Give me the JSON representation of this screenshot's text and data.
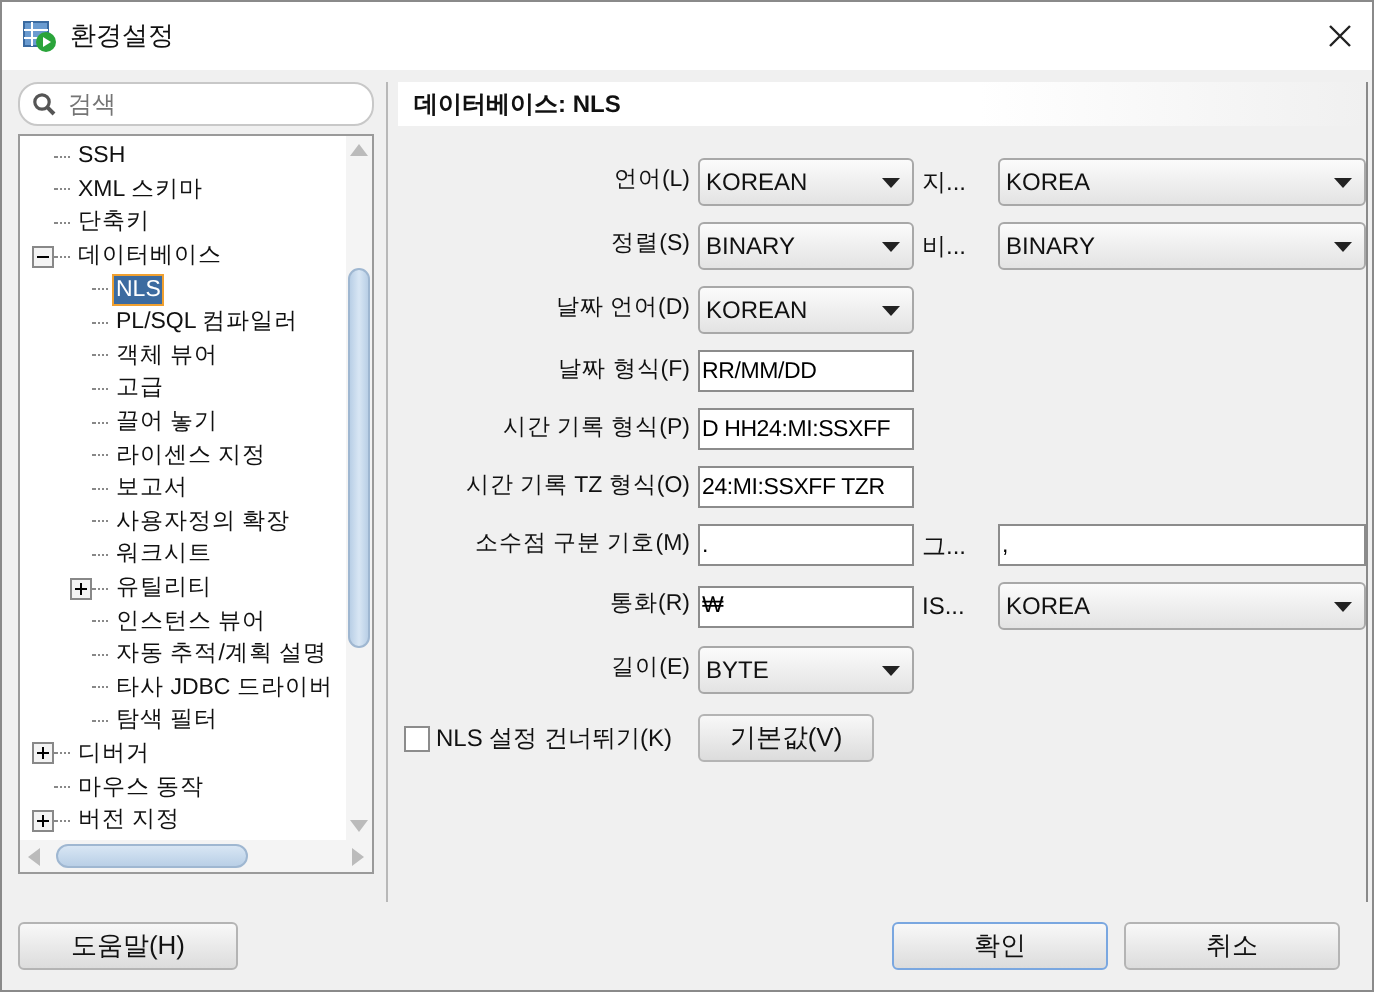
{
  "window": {
    "title": "환경설정"
  },
  "search": {
    "placeholder": "검색"
  },
  "tree": [
    {
      "label": "SSH",
      "selected": false
    },
    {
      "label": "XML 스키마",
      "selected": false
    },
    {
      "label": "단축키",
      "selected": false
    },
    {
      "label": "데이터베이스",
      "selected": false,
      "expanded": true,
      "children": [
        {
          "label": "NLS",
          "selected": true
        },
        {
          "label": "PL/SQL 컴파일러",
          "selected": false
        },
        {
          "label": "객체 뷰어",
          "selected": false
        },
        {
          "label": "고급",
          "selected": false
        },
        {
          "label": "끌어 놓기",
          "selected": false
        },
        {
          "label": "라이센스 지정",
          "selected": false
        },
        {
          "label": "보고서",
          "selected": false
        },
        {
          "label": "사용자정의 확장",
          "selected": false
        },
        {
          "label": "워크시트",
          "selected": false
        },
        {
          "label": "유틸리티",
          "selected": false,
          "expanded": false
        },
        {
          "label": "인스턴스 뷰어",
          "selected": false
        },
        {
          "label": "자동 추적/계획 설명",
          "selected": false
        },
        {
          "label": "타사 JDBC 드라이버",
          "selected": false
        },
        {
          "label": "탐색 필터",
          "selected": false
        }
      ]
    },
    {
      "label": "디버거",
      "selected": false,
      "expanded": false
    },
    {
      "label": "마우스 동작",
      "selected": false
    },
    {
      "label": "버전 지정",
      "selected": false,
      "expanded": false
    }
  ],
  "panel": {
    "title": "데이터베이스: NLS",
    "fields": [
      {
        "label": "언어(L)",
        "kind": "combo",
        "value": "KOREAN",
        "second": {
          "label": "지...",
          "kind": "combo",
          "value": "KOREA"
        }
      },
      {
        "label": "정렬(S)",
        "kind": "combo",
        "value": "BINARY",
        "second": {
          "label": "비...",
          "kind": "combo",
          "value": "BINARY"
        }
      },
      {
        "label": "날짜 언어(D)",
        "kind": "combo",
        "value": "KOREAN"
      },
      {
        "label": "날짜 형식(F)",
        "kind": "text",
        "value": "RR/MM/DD"
      },
      {
        "label": "시간 기록 형식(P)",
        "kind": "text",
        "value": "D HH24:MI:SSXFF"
      },
      {
        "label": "시간 기록 TZ 형식(O)",
        "kind": "text",
        "value": "24:MI:SSXFF TZR"
      },
      {
        "label": "소수점 구분 기호(M)",
        "kind": "text",
        "value": ".",
        "second": {
          "label": "그...",
          "kind": "text",
          "value": ","
        }
      },
      {
        "label": "통화(R)",
        "kind": "text",
        "value": "₩",
        "second": {
          "label": "IS...",
          "kind": "combo",
          "value": "KOREA"
        }
      },
      {
        "label": "길이(E)",
        "kind": "combo",
        "value": "BYTE"
      }
    ],
    "skip_checkbox": {
      "label": "NLS 설정 건너뛰기(K)",
      "checked": false
    },
    "default_button": "기본값(V)"
  },
  "help_button": "도움말(H)",
  "buttons": [
    {
      "label": "확인",
      "focused": true
    },
    {
      "label": "취소",
      "focused": false
    }
  ]
}
